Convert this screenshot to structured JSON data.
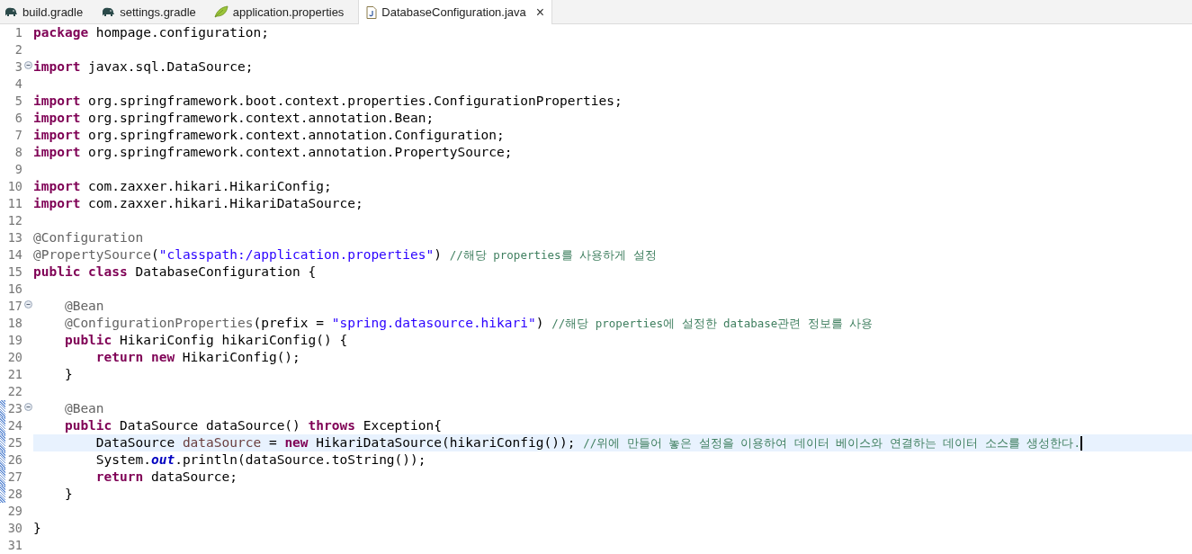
{
  "tabs": [
    {
      "label": "build.gradle",
      "kind": "gradle",
      "selected": false
    },
    {
      "label": "settings.gradle",
      "kind": "gradle",
      "selected": false
    },
    {
      "label": "application.properties",
      "kind": "properties",
      "selected": false
    },
    {
      "label": "DatabaseConfiguration.java",
      "kind": "java",
      "selected": true,
      "close": "×"
    }
  ],
  "lines": [
    {
      "number": "1",
      "tokens": [
        {
          "kind": "keyword",
          "text": "package"
        },
        {
          "kind": "plain",
          "text": " hompage.configuration;"
        }
      ]
    },
    {
      "number": "2"
    },
    {
      "number": "3",
      "fold": true,
      "tokens": [
        {
          "kind": "keyword",
          "text": "import"
        },
        {
          "kind": "plain",
          "text": " javax.sql.DataSource;"
        }
      ]
    },
    {
      "number": "4"
    },
    {
      "number": "5",
      "tokens": [
        {
          "kind": "keyword",
          "text": "import"
        },
        {
          "kind": "plain",
          "text": " org.springframework.boot.context.properties.ConfigurationProperties;"
        }
      ]
    },
    {
      "number": "6",
      "tokens": [
        {
          "kind": "keyword",
          "text": "import"
        },
        {
          "kind": "plain",
          "text": " org.springframework.context.annotation.Bean;"
        }
      ]
    },
    {
      "number": "7",
      "tokens": [
        {
          "kind": "keyword",
          "text": "import"
        },
        {
          "kind": "plain",
          "text": " org.springframework.context.annotation.Configuration;"
        }
      ]
    },
    {
      "number": "8",
      "tokens": [
        {
          "kind": "keyword",
          "text": "import"
        },
        {
          "kind": "plain",
          "text": " org.springframework.context.annotation.PropertySource;"
        }
      ]
    },
    {
      "number": "9"
    },
    {
      "number": "10",
      "tokens": [
        {
          "kind": "keyword",
          "text": "import"
        },
        {
          "kind": "plain",
          "text": " com.zaxxer.hikari.HikariConfig;"
        }
      ]
    },
    {
      "number": "11",
      "tokens": [
        {
          "kind": "keyword",
          "text": "import"
        },
        {
          "kind": "plain",
          "text": " com.zaxxer.hikari.HikariDataSource;"
        }
      ]
    },
    {
      "number": "12"
    },
    {
      "number": "13",
      "tokens": [
        {
          "kind": "annotation",
          "text": "@Configuration"
        }
      ]
    },
    {
      "number": "14",
      "tokens": [
        {
          "kind": "annotation",
          "text": "@PropertySource"
        },
        {
          "kind": "plain",
          "text": "("
        },
        {
          "kind": "string",
          "text": "\"classpath:/application.properties\""
        },
        {
          "kind": "plain",
          "text": ") "
        },
        {
          "kind": "comment",
          "text": "//해당 properties를 사용하게 설정"
        }
      ]
    },
    {
      "number": "15",
      "tokens": [
        {
          "kind": "keyword",
          "text": "public class"
        },
        {
          "kind": "plain",
          "text": " DatabaseConfiguration {"
        }
      ]
    },
    {
      "number": "16"
    },
    {
      "number": "17",
      "fold": true,
      "tokens": [
        {
          "kind": "annotation",
          "text": "    @Bean"
        }
      ]
    },
    {
      "number": "18",
      "tokens": [
        {
          "kind": "annotation",
          "text": "    @ConfigurationProperties"
        },
        {
          "kind": "plain",
          "text": "(prefix = "
        },
        {
          "kind": "string",
          "text": "\"spring.datasource.hikari\""
        },
        {
          "kind": "plain",
          "text": ") "
        },
        {
          "kind": "comment",
          "text": "//해당 properties에 설정한 database관련 정보를 사용"
        }
      ]
    },
    {
      "number": "19",
      "tokens": [
        {
          "kind": "keyword",
          "text": "    public"
        },
        {
          "kind": "plain",
          "text": " HikariConfig hikariConfig() {"
        }
      ]
    },
    {
      "number": "20",
      "tokens": [
        {
          "kind": "keyword",
          "text": "        return new"
        },
        {
          "kind": "plain",
          "text": " HikariConfig();"
        }
      ]
    },
    {
      "number": "21",
      "tokens": [
        {
          "kind": "plain",
          "text": "    }"
        }
      ]
    },
    {
      "number": "22"
    },
    {
      "number": "23",
      "fold": true,
      "changed": true,
      "tokens": [
        {
          "kind": "annotation",
          "text": "    @Bean"
        }
      ]
    },
    {
      "number": "24",
      "changed": true,
      "tokens": [
        {
          "kind": "keyword",
          "text": "    public"
        },
        {
          "kind": "plain",
          "text": " DataSource dataSource() "
        },
        {
          "kind": "keyword",
          "text": "throws"
        },
        {
          "kind": "plain",
          "text": " Exception{"
        }
      ]
    },
    {
      "number": "25",
      "changed": true,
      "current": true,
      "tokens": [
        {
          "kind": "plain",
          "text": "        DataSource "
        },
        {
          "kind": "variable",
          "text": "dataSource"
        },
        {
          "kind": "plain",
          "text": " = "
        },
        {
          "kind": "keyword",
          "text": "new"
        },
        {
          "kind": "plain",
          "text": " HikariDataSource(hikariConfig()); "
        },
        {
          "kind": "comment",
          "text": "//위에 만들어 놓은 설정을 이용하여 데이터 베이스와 연결하는 데이터 소스를 생성한다."
        }
      ]
    },
    {
      "number": "26",
      "changed": true,
      "tokens": [
        {
          "kind": "plain",
          "text": "        System."
        },
        {
          "kind": "field",
          "text": "out"
        },
        {
          "kind": "plain",
          "text": ".println(dataSource.toString());"
        }
      ]
    },
    {
      "number": "27",
      "changed": true,
      "tokens": [
        {
          "kind": "keyword",
          "text": "        return"
        },
        {
          "kind": "plain",
          "text": " dataSource;"
        }
      ]
    },
    {
      "number": "28",
      "changed": true,
      "tokens": [
        {
          "kind": "plain",
          "text": "    }"
        }
      ]
    },
    {
      "number": "29"
    },
    {
      "number": "30",
      "tokens": [
        {
          "kind": "plain",
          "text": "}"
        }
      ]
    },
    {
      "number": "31"
    }
  ]
}
